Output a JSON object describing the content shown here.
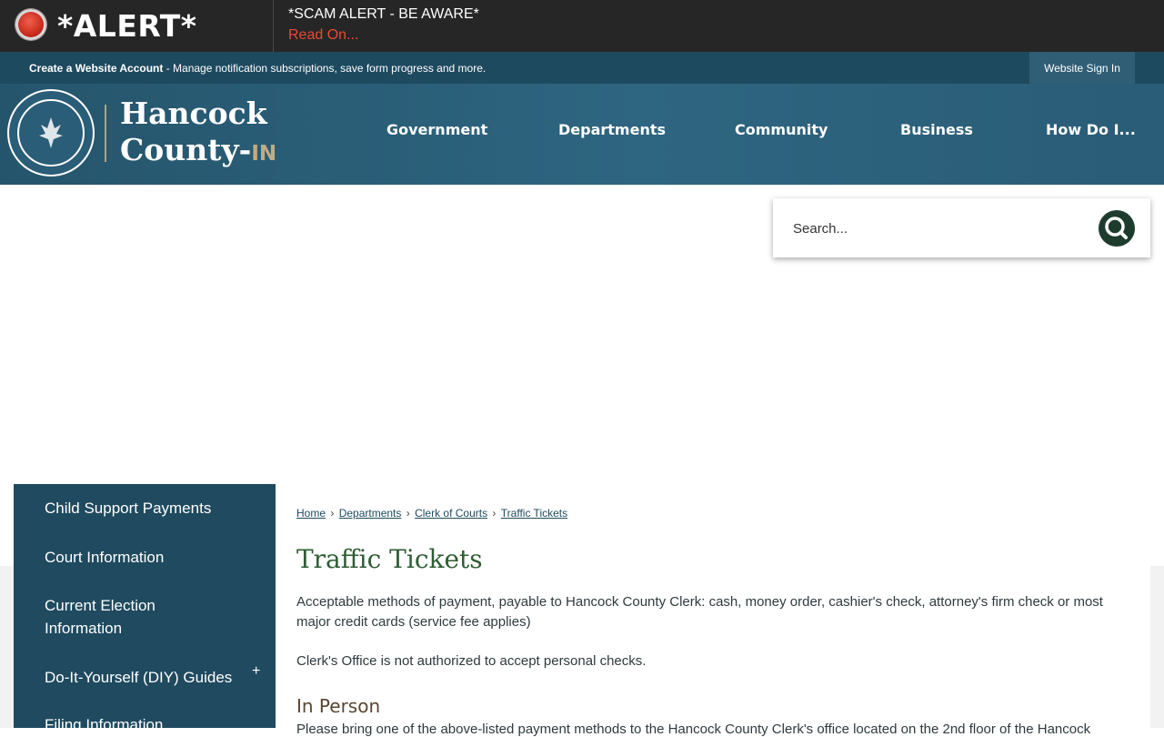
{
  "alert": {
    "label": "*ALERT*",
    "title": "*SCAM ALERT - BE AWARE*",
    "link": "Read On..."
  },
  "account_bar": {
    "create_link": "Create a Website Account",
    "description": " - Manage notification subscriptions, save form progress and more.",
    "sign_in": "Website Sign In"
  },
  "logo": {
    "line1": "Hancock",
    "line2": "County-",
    "suffix": "IN",
    "seal_icon": "county-seal-icon"
  },
  "nav": [
    "Government",
    "Departments",
    "Community",
    "Business",
    "How Do I..."
  ],
  "search": {
    "placeholder": "Search...",
    "icon": "search-icon"
  },
  "sidebar": {
    "items": [
      {
        "label": "Child Support Payments"
      },
      {
        "label": "Court Information"
      },
      {
        "label": "Current Election Information"
      },
      {
        "label": "Do-It-Yourself (DIY) Guides",
        "expand": "+"
      },
      {
        "label": "Filing Information"
      }
    ]
  },
  "breadcrumb": [
    "Home",
    "Departments",
    "Clerk of Courts",
    "Traffic Tickets"
  ],
  "page": {
    "title": "Traffic Tickets",
    "para1": "Acceptable methods of payment, payable to Hancock County Clerk: cash, money order, cashier's check, attorney's firm check or most major credit cards (service fee applies)",
    "para2": "Clerk's Office is not authorized to accept personal checks.",
    "section_heading": "In Person",
    "para3": "Please bring one of the above-listed payment methods to the Hancock County Clerk's office located on the 2nd floor of the Hancock"
  },
  "colors": {
    "alert_bg": "#262626",
    "brand_teal": "#1e4a60",
    "alert_link": "#e94a35",
    "title_green": "#2f5d35",
    "search_button": "#1e3c2e"
  }
}
